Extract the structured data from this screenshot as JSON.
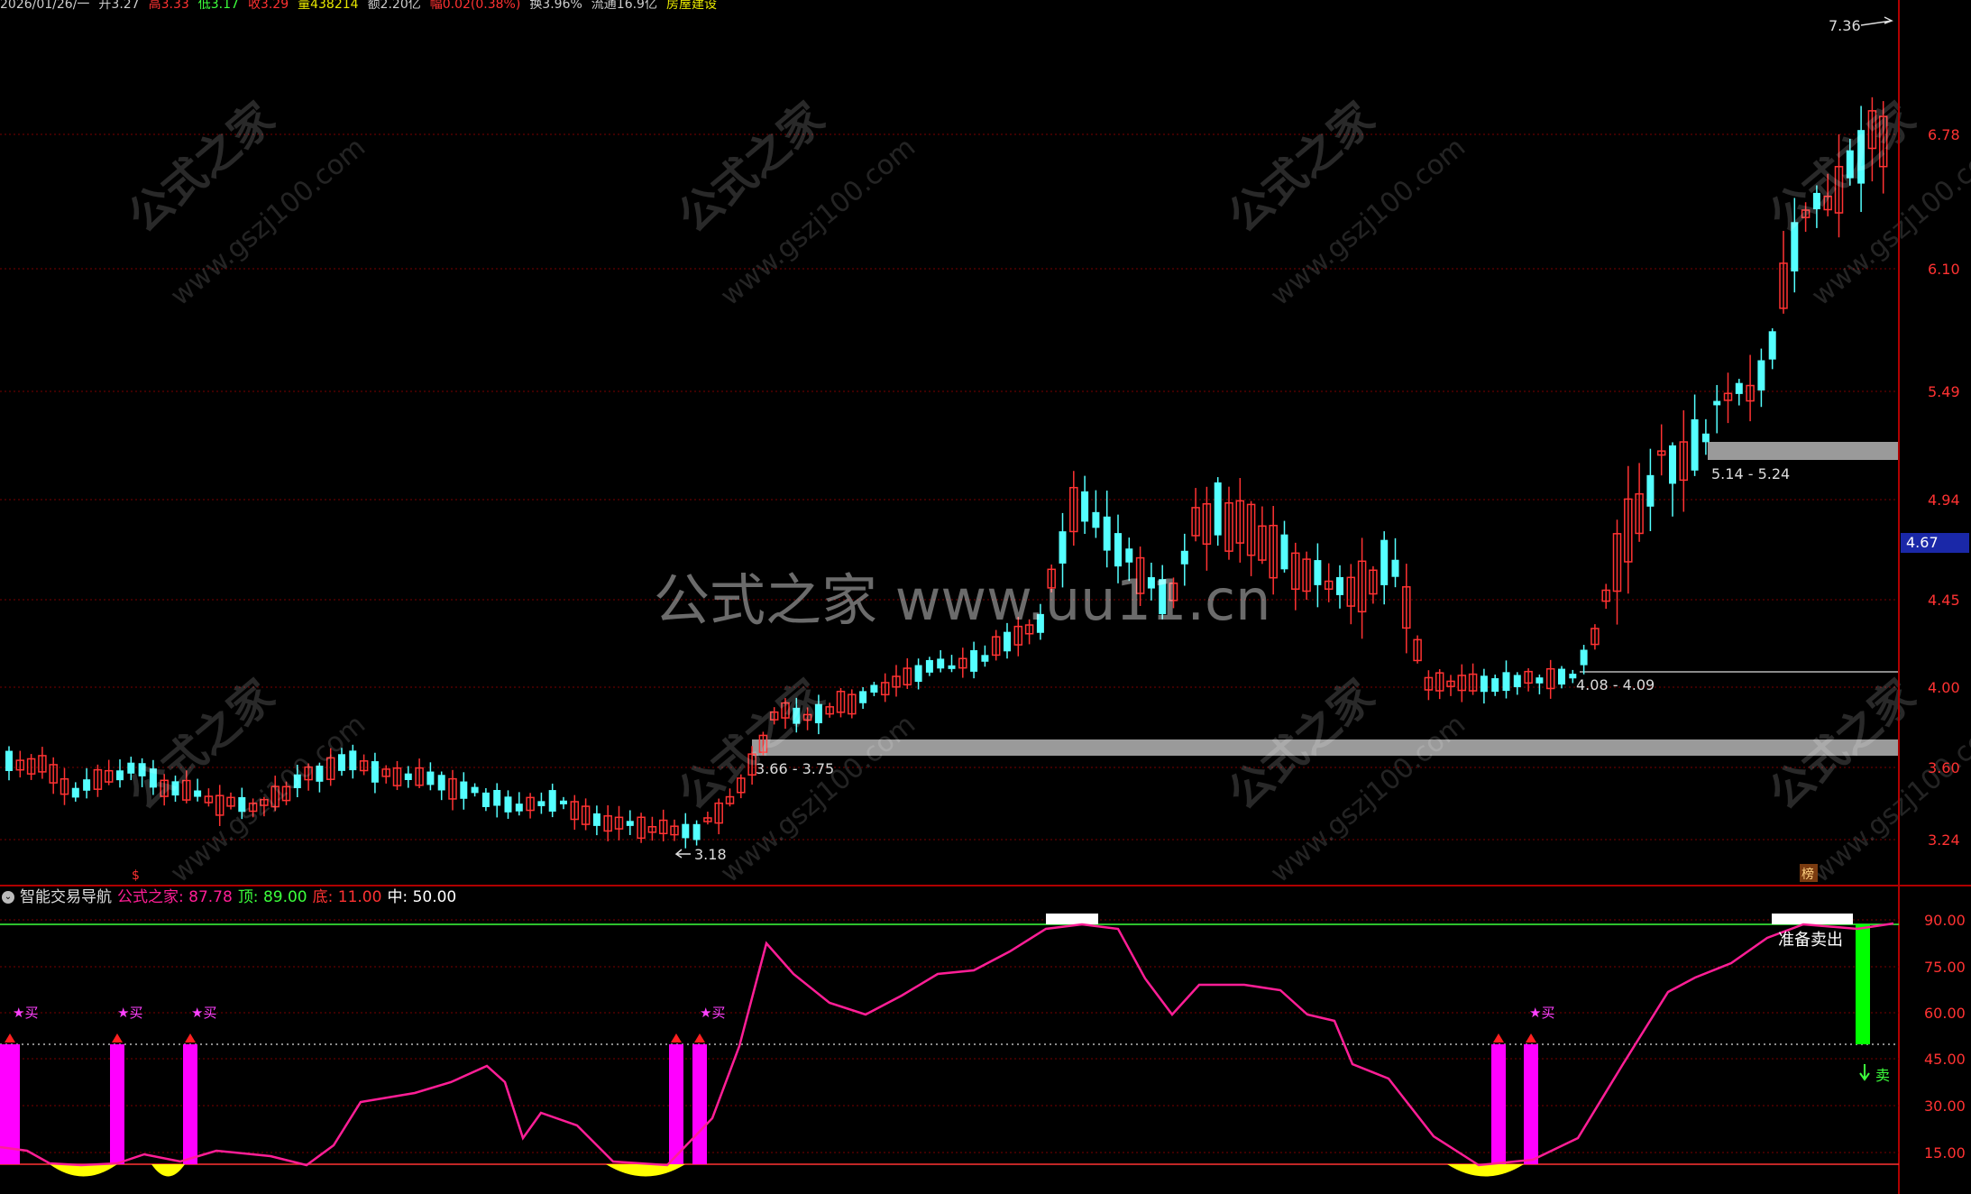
{
  "info_bar": {
    "date": "2026/01/26/一",
    "open": "开3.27",
    "high": "高3.33",
    "low": "低3.17",
    "close": "收3.29",
    "volume": "量438214",
    "amount": "额2.20亿",
    "change": "幅0.02(0.38%)",
    "turnover": "换3.96%",
    "float_cap": "流通16.9亿",
    "sector": "房屋建设"
  },
  "price_axis": [
    "6.78",
    "6.10",
    "5.49",
    "4.94",
    "4.45",
    "4.00",
    "3.60",
    "3.24"
  ],
  "current_price": "4.67",
  "annotations": {
    "peak": "7.36",
    "low": "3.18",
    "zone_low": "3.66 - 3.75",
    "zone_mid": "4.08 - 4.09",
    "zone_high": "5.14 - 5.24",
    "bottom_marker": "$",
    "top_marker": "榜"
  },
  "watermarks": {
    "center": "公式之家 www.uu11.cn",
    "diag_cn": "公式之家",
    "diag_url": "www.gszj100.com"
  },
  "indicator": {
    "name": "智能交易导航",
    "value_label": "公式之家: 87.78",
    "top_label": "顶: 89.00",
    "bottom_label": "底: 11.00",
    "mid_label": "中: 50.00",
    "axis": [
      "90.00",
      "75.00",
      "60.00",
      "45.00",
      "30.00",
      "15.00"
    ],
    "buy_signal": "★买",
    "sell_signal": "卖",
    "prepare_sell": "准备卖出"
  },
  "colors": {
    "up": "#ff3232",
    "down": "#54ffff",
    "line": "#ff1e96",
    "buy_bar": "#ff00ff",
    "sell_bar": "#00ff00",
    "zone": "#9a9a9a",
    "grid": "#7a0000"
  }
}
